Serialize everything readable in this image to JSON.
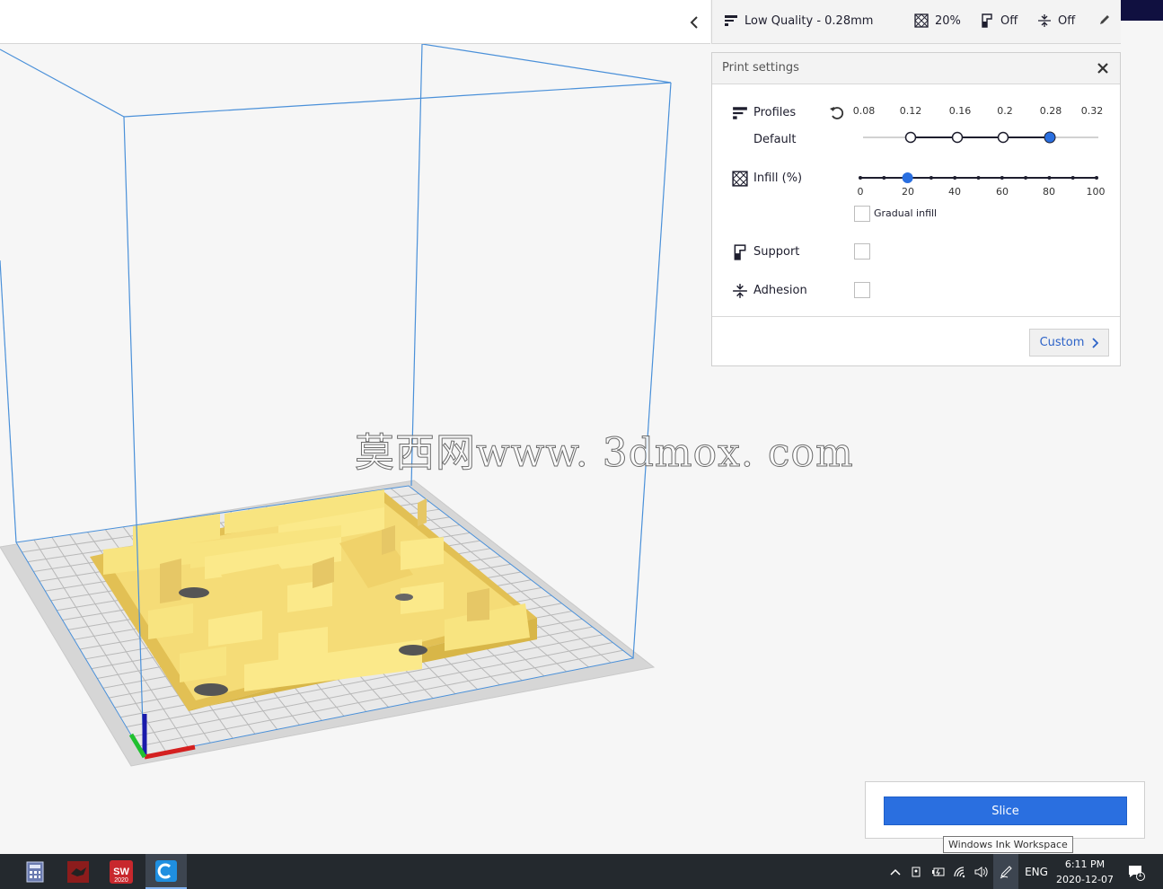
{
  "summary_bar": {
    "profile_label": "Low Quality - 0.28mm",
    "infill_value": "20%",
    "support_value": "Off",
    "adhesion_value": "Off",
    "icons": [
      "profile-icon",
      "infill-icon",
      "support-icon",
      "adhesion-icon",
      "pencil-icon"
    ]
  },
  "print_settings": {
    "title": "Print settings",
    "profiles": {
      "label": "Profiles",
      "sublabel": "Default",
      "ticks": [
        "0.08",
        "0.12",
        "0.16",
        "0.2",
        "0.28",
        "0.32"
      ],
      "selected": "0.28"
    },
    "infill": {
      "label": "Infill (%)",
      "ticks": [
        "0",
        "20",
        "40",
        "60",
        "80",
        "100"
      ],
      "value": 20,
      "gradual_label": "Gradual infill",
      "gradual_checked": false
    },
    "support": {
      "label": "Support",
      "checked": false
    },
    "adhesion": {
      "label": "Adhesion",
      "checked": false
    },
    "custom_label": "Custom"
  },
  "slice": {
    "label": "Slice"
  },
  "tooltip": "Windows Ink Workspace",
  "watermark": "莫西网www. 3dmox. com",
  "taskbar": {
    "apps": [
      "calculator",
      "app-red",
      "solidworks-2020",
      "cura"
    ],
    "sw_badge": "2020",
    "language": "ENG",
    "time": "6:11 PM",
    "date": "2020-12-07",
    "notification_count": "1"
  },
  "colors": {
    "accent": "#2a6fe0",
    "model": "#f7e07a",
    "build_volume": "#4a90d9",
    "taskbar": "#24292e"
  }
}
